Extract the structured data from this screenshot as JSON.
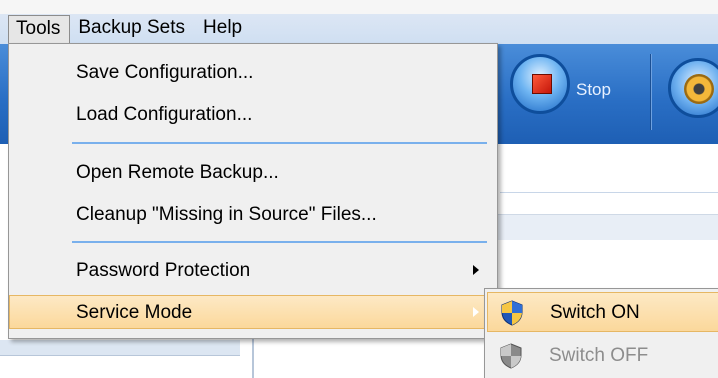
{
  "menubar": {
    "items": [
      {
        "label": "Tools",
        "open": true
      },
      {
        "label": "Backup Sets"
      },
      {
        "label": "Help"
      }
    ]
  },
  "toolbar": {
    "stop_label": "Stop"
  },
  "tools_menu": {
    "items": [
      {
        "label": "Save Configuration..."
      },
      {
        "label": "Load Configuration..."
      },
      {
        "label": "Open Remote Backup..."
      },
      {
        "label": "Cleanup \"Missing in Source\" Files..."
      },
      {
        "label": "Password Protection",
        "submenu": true
      },
      {
        "label": "Service Mode",
        "submenu": true,
        "highlighted": true
      }
    ]
  },
  "service_mode_submenu": {
    "items": [
      {
        "label": "Switch ON",
        "highlighted": true,
        "icon": "uac-shield-icon"
      },
      {
        "label": "Switch OFF",
        "disabled": true,
        "icon": "uac-shield-gray-icon"
      }
    ]
  },
  "colors": {
    "menu_bg": "#f0f0f0",
    "highlight": "#fbd89b",
    "separator": "#79b0ec",
    "toolbar": "#2a6fc5"
  }
}
